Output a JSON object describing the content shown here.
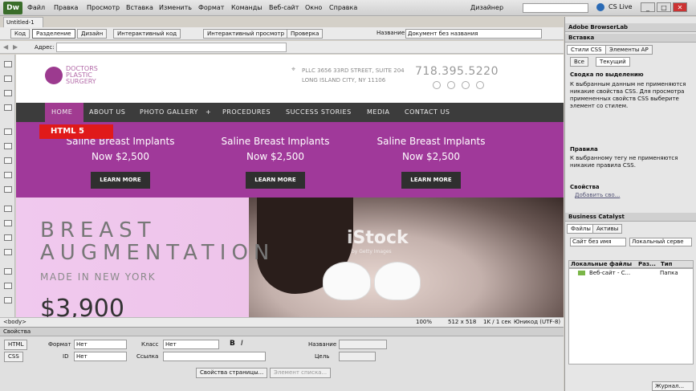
{
  "app": {
    "logo": "Dw",
    "menus": [
      "Файл",
      "Правка",
      "Просмотр",
      "Вставка",
      "Изменить",
      "Формат",
      "Команды",
      "Веб-сайт",
      "Окно",
      "Справка"
    ],
    "workspace": "Дизайнер",
    "cslive": "CS Live",
    "window_buttons": [
      "_",
      "□",
      "✕"
    ]
  },
  "document": {
    "tab": "Untitled-1",
    "views": [
      "Код",
      "Разделение",
      "Дизайн",
      "Интерактивный код",
      "Интерактивный просмотр",
      "Проверка"
    ],
    "title_label": "Название:",
    "title_value": "Документ без названия",
    "address_label": "Адрес:"
  },
  "site": {
    "logo_lines": [
      "DOCTORS",
      "PLASTIC",
      "SURGERY"
    ],
    "address_line1": "PLLC 3656 33RD STREET, SUITE 204",
    "address_line2": "LONG ISLAND CITY, NY 11106",
    "phone": "718.395.5220",
    "nav": [
      "HOME",
      "ABOUT US",
      "PHOTO GALLERY",
      "+",
      "PROCEDURES",
      "SUCCESS STORIES",
      "MEDIA",
      "CONTACT US"
    ],
    "badge": "HTML 5",
    "promos": [
      {
        "title": "Saline Breast Implants",
        "price": "Now $2,500",
        "button": "LEARN MORE"
      },
      {
        "title": "Saline Breast Implants",
        "price": "Now $2,500",
        "button": "LEARN MORE"
      },
      {
        "title": "Saline Breast Implants",
        "price": "Now $2,500",
        "button": "LEARN MORE"
      }
    ],
    "hero_line1": "BREAST",
    "hero_line2": "AUGMENTATION",
    "hero_sub": "MADE IN NEW YORK",
    "hero_price": "$3,900",
    "watermark": "iStock",
    "watermark_sub": "by Getty Images"
  },
  "status": {
    "tag": "<body>",
    "zoom": "100%",
    "size": "512 x 518",
    "info": "1K / 1 сек",
    "encoding": "Юникод (UTF-8)"
  },
  "properties": {
    "title": "Свойства",
    "html_btn": "HTML",
    "css_btn": "CSS",
    "format_label": "Формат",
    "format_value": "Нет",
    "id_label": "ID",
    "id_value": "Нет",
    "class_label": "Класс",
    "class_value": "Нет",
    "link_label": "Ссылка",
    "name_label": "Название",
    "target_label": "Цель",
    "page_props": "Свойства страницы...",
    "list_item": "Элемент списка..."
  },
  "right": {
    "browserlab": "Adobe BrowserLab",
    "insert": "Вставка",
    "css_tab": "Стили CSS",
    "ap_tab": "Элементы AP",
    "all": "Все",
    "current": "Текущий",
    "summary_title": "Сводка по выделению",
    "summary_text": "К выбранным данным не применяются никакие свойства CSS. Для просмотра примененных свойств CSS выберите элемент со стилем.",
    "rules_title": "Правила",
    "rules_text": "К выбранному тегу не применяются никакие правила CSS.",
    "props_title": "Свойства",
    "add_prop": "Добавить сво...",
    "bc": "Business Catalyst",
    "files_tab": "Файлы",
    "assets_tab": "Активы",
    "site_select": "Сайт без имя",
    "local_select": "Локальный серве",
    "col_local": "Локальные файлы",
    "col_size": "Раз...",
    "col_type": "Тип",
    "row_name": "Веб-сайт - С...",
    "row_type": "Папка",
    "journal": "Журнал..."
  }
}
